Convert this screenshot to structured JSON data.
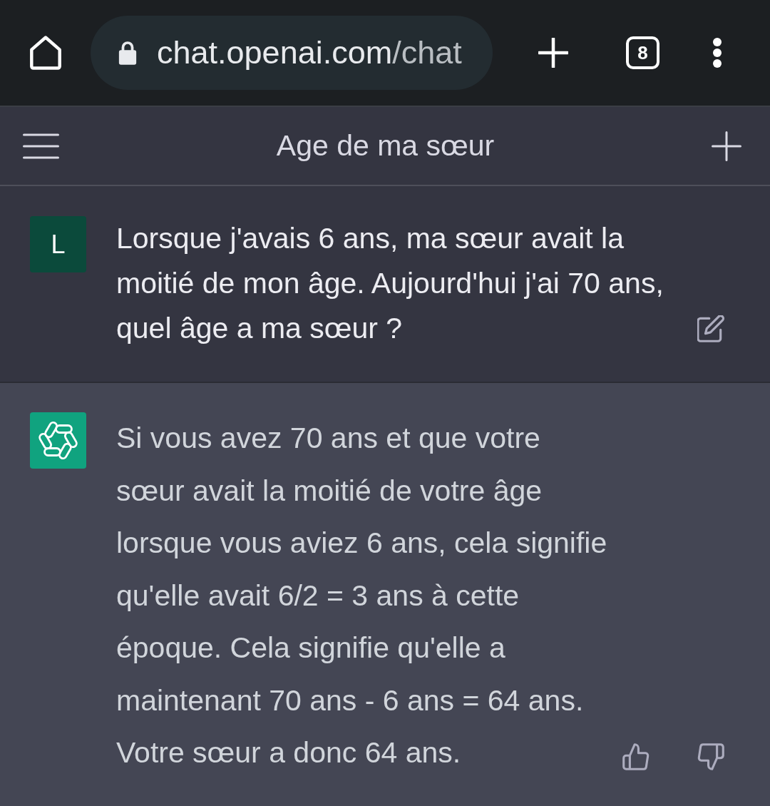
{
  "browser": {
    "address": {
      "host": "chat.openai.com",
      "path": "/chat"
    },
    "tab_count": "8"
  },
  "header": {
    "title": "Age de ma sœur"
  },
  "messages": [
    {
      "kind": "user",
      "avatar": "L",
      "lines": [
        "Lorsque j'avais 6 ans, ma sœur avait la",
        "moitié de mon âge. Aujourd'hui j'ai 70 ans,",
        "quel âge a ma sœur ?"
      ]
    },
    {
      "kind": "assistant",
      "lines": [
        "Si vous avez 70 ans et que votre",
        "sœur avait la moitié de votre âge",
        "lorsque vous aviez 6 ans, cela signifie",
        "qu'elle avait 6/2 = 3 ans à cette",
        "époque. Cela signifie qu'elle a",
        "maintenant 70 ans - 6 ans = 64 ans.",
        "Votre sœur a donc 64 ans."
      ]
    }
  ]
}
